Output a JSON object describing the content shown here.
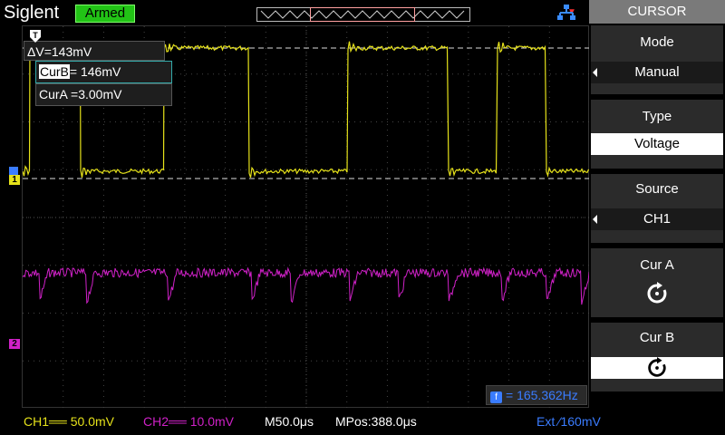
{
  "header": {
    "brand": "Siglent",
    "status": "Armed",
    "network_icon": "network-icon"
  },
  "cursor_readout": {
    "delta": "ΔV=143mV",
    "curb_label": "CurB",
    "curb_value": "= 146mV",
    "cura": "CurA =3.00mV"
  },
  "frequency": {
    "icon": "f",
    "value": "= 165.362Hz"
  },
  "channel_markers": {
    "ch1": "1",
    "ch2": "2",
    "trigger": "T"
  },
  "menu": {
    "title": "CURSOR",
    "items": [
      {
        "label": "Mode",
        "value": "Manual"
      },
      {
        "label": "Type",
        "value": "Voltage"
      },
      {
        "label": "Source",
        "value": "CH1"
      },
      {
        "label": "Cur A",
        "icon": "rotate-knob-icon"
      },
      {
        "label": "Cur B",
        "icon": "rotate-knob-icon"
      }
    ]
  },
  "status_bar": {
    "ch1": "CH1══ 50.0mV",
    "ch2": "CH2══ 10.0mV",
    "timebase": "M50.0μs",
    "mpos": "MPos:388.0μs",
    "trigger": "Ext  ⁄160mV"
  },
  "colors": {
    "ch1": "#e6e21a",
    "ch2": "#d021c8",
    "accent": "#3a7cff",
    "armed": "#22c316"
  }
}
